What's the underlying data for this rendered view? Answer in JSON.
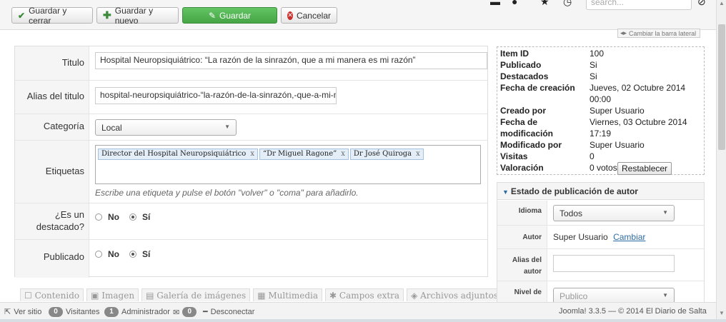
{
  "toolbar": {
    "save_close": "Guardar y cerrar",
    "save_new": "Guardar y nuevo",
    "save": "Guardar",
    "cancel": "Cancelar",
    "search_placeholder": "search...",
    "toggle_sidebar": "Cambiar la barra lateral"
  },
  "form": {
    "title_label": "Titulo",
    "title_value": "Hospital Neuropsiquiátrico: “La razón de la sinrazón, que a mi manera es mi razón”",
    "alias_label": "Alias del titulo",
    "alias_value": "hospital-neuropsiquiátrico-“la-razón-de-la-sinrazón,-que-a-mi-m",
    "category_label": "Categoría",
    "category_value": "Local",
    "tags_label": "Etiquetas",
    "tags": [
      "Director del Hospital Neuropsiquiátrico",
      "“Dr Miguel Ragone”",
      "Dr José Quiroga"
    ],
    "tags_hint": "Escribe una etiqueta y pulse el botón \"volver\" o \"coma\" para añadirlo.",
    "featured_label_1": "¿Es un",
    "featured_label_2": "destacado?",
    "published_label": "Publicado",
    "no": "No",
    "yes": "Sí"
  },
  "tabs": [
    "Contenido",
    "Imagen",
    "Galería de imágenes",
    "Multimedia",
    "Campos extra",
    "Archivos adjuntos"
  ],
  "info": {
    "item_id_k": "Item ID",
    "item_id_v": "100",
    "published_k": "Publicado",
    "published_v": "Si",
    "featured_k": "Destacados",
    "featured_v": "Si",
    "created_k": "Fecha de creación",
    "created_v1": "Jueves, 02 Octubre 2014",
    "created_v2": "00:00",
    "created_by_k": "Creado por",
    "created_by_v": "Super Usuario",
    "modified_k1": "Fecha de",
    "modified_k2": "modificación",
    "modified_v1": "Viernes, 03 Octubre 2014",
    "modified_v2": "17:19",
    "modified_by_k": "Modificado por",
    "modified_by_v": "Super Usuario",
    "hits_k": "Visitas",
    "hits_v": "0",
    "rating_k": "Valoración",
    "rating_v": "0 votos",
    "reset": "Restablecer"
  },
  "publishing": {
    "header": "Estado de publicación de autor",
    "language_label": "Idioma",
    "language_value": "Todos",
    "author_label": "Autor",
    "author_value": "Super Usuario",
    "change": "Cambiar",
    "alias_label_1": "Alias del",
    "alias_label_2": "autor",
    "access_label": "Nivel de",
    "access_value": "Publico"
  },
  "status": {
    "view_site": "Ver sitio",
    "visitors_count": "0",
    "visitors": "Visitantes",
    "admin_count": "1",
    "admin": "Administrador",
    "messages_count": "0",
    "logout": "Desconectar",
    "footer": "Joomla! 3.3.5 — © 2014 El Diario de Salta"
  }
}
